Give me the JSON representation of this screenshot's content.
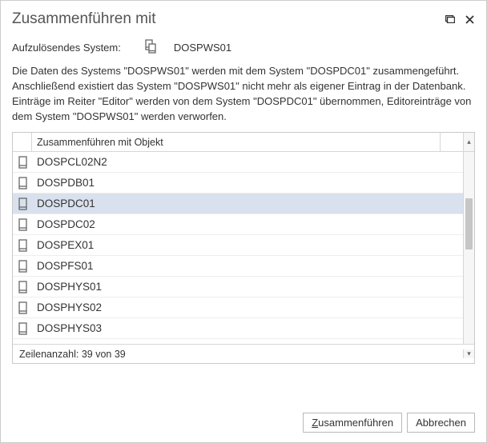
{
  "title": "Zusammenführen mit",
  "resolving": {
    "label": "Aufzulösendes System:",
    "value": "DOSPWS01"
  },
  "description": "Die Daten des Systems \"DOSPWS01\" werden mit dem System \"DOSPDC01\" zusammengeführt. Anschließend existiert das System \"DOSPWS01\" nicht mehr als eigener Eintrag in der Datenbank. Einträge im Reiter \"Editor\" werden von dem System \"DOSPDC01\" übernommen, Editoreinträge von dem System \"DOSPWS01\" werden verworfen.",
  "table": {
    "header": "Zusammenführen mit Objekt",
    "rows": [
      {
        "name": "DOSPCL02N2",
        "selected": false
      },
      {
        "name": "DOSPDB01",
        "selected": false
      },
      {
        "name": "DOSPDC01",
        "selected": true
      },
      {
        "name": "DOSPDC02",
        "selected": false
      },
      {
        "name": "DOSPEX01",
        "selected": false
      },
      {
        "name": "DOSPFS01",
        "selected": false
      },
      {
        "name": "DOSPHYS01",
        "selected": false
      },
      {
        "name": "DOSPHYS02",
        "selected": false
      },
      {
        "name": "DOSPHYS03",
        "selected": false
      }
    ],
    "row_count_label": "Zeilenanzahl: 39 von 39"
  },
  "buttons": {
    "merge": {
      "accel": "Z",
      "rest": "usammenführen"
    },
    "cancel": {
      "text": "Abbrechen"
    }
  }
}
